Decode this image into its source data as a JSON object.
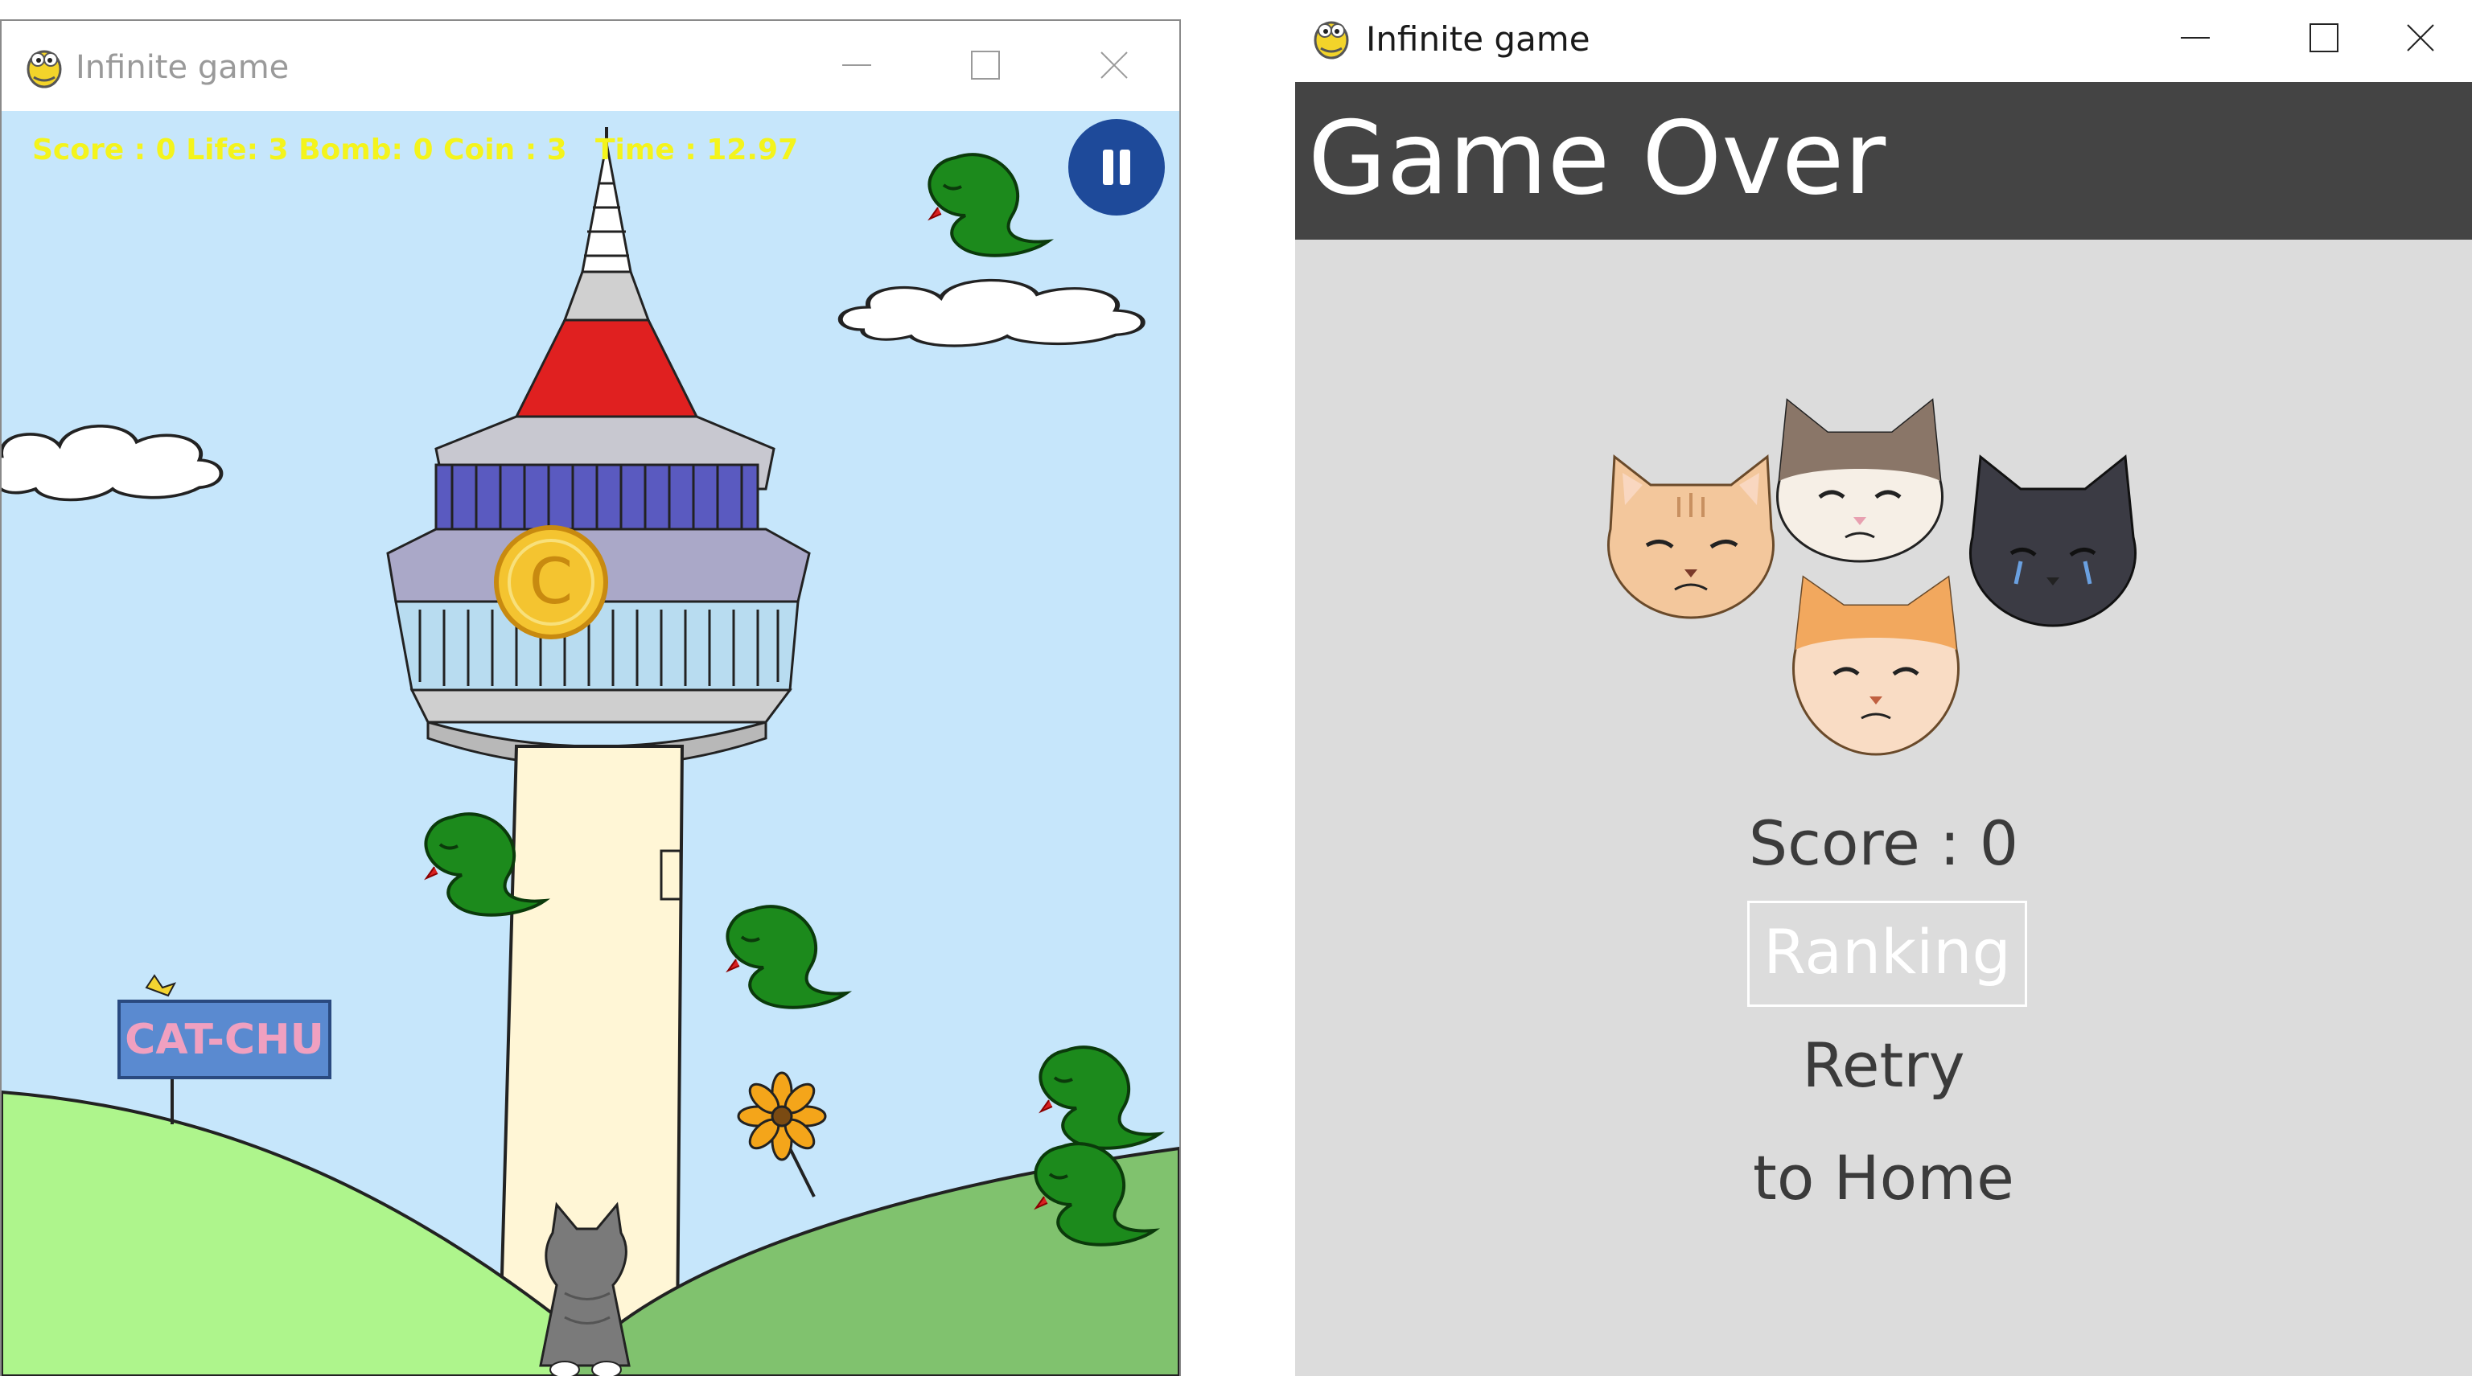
{
  "left_window": {
    "title": "Infinite game",
    "hud": {
      "stats": "Score : 0 Life: 3 Bomb: 0 Coin : 3",
      "time": "Time : 12.97"
    },
    "sign_text": "CAT-CHU",
    "coin_letter": "C"
  },
  "right_window": {
    "title": "Infinite game",
    "header": "Game Over",
    "score": "Score : 0",
    "menu": {
      "ranking": "Ranking",
      "retry": "Retry",
      "home": "to Home"
    }
  },
  "colors": {
    "sky": "#c6e6fb",
    "hud_text": "#f4f41c",
    "pause_button": "#1e4a9a",
    "game_over_header": "#444444",
    "game_over_body": "#dcdcdc"
  },
  "icons": [
    "python-app-icon",
    "minimize-icon",
    "maximize-icon",
    "close-icon",
    "pause-icon"
  ]
}
